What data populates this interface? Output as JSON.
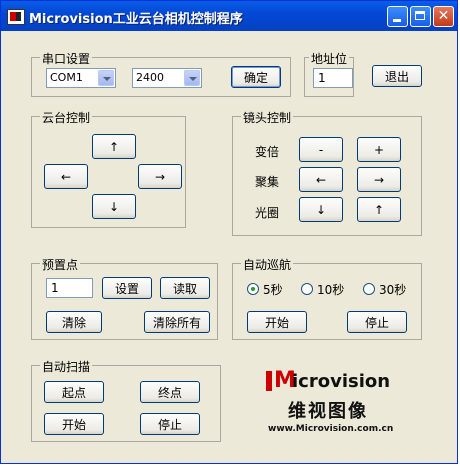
{
  "window": {
    "title": "Microvision工业云台相机控制程序"
  },
  "serial": {
    "legend": "串口设置",
    "port": "COM1",
    "baud": "2400",
    "confirm": "确定"
  },
  "address": {
    "legend": "地址位",
    "value": "1",
    "exit": "退出"
  },
  "ptz": {
    "legend": "云台控制",
    "up": "↑",
    "left": "←",
    "right": "→",
    "down": "↓"
  },
  "lens": {
    "legend": "镜头控制",
    "zoom_label": "变倍",
    "zoom_minus": "-",
    "zoom_plus": "+",
    "focus_label": "聚集",
    "focus_left": "←",
    "focus_right": "→",
    "iris_label": "光圈",
    "iris_down": "↓",
    "iris_up": "↑"
  },
  "preset": {
    "legend": "预置点",
    "value": "1",
    "set": "设置",
    "read": "读取",
    "clear": "清除",
    "clear_all": "清除所有"
  },
  "cruise": {
    "legend": "自动巡航",
    "opt1": "5秒",
    "opt2": "10秒",
    "opt3": "30秒",
    "selected": "5秒",
    "start": "开始",
    "stop": "停止"
  },
  "scan": {
    "legend": "自动扫描",
    "start_point": "起点",
    "end_point": "终点",
    "start": "开始",
    "stop": "停止"
  },
  "brand": {
    "logo_m": "M",
    "logo_rest": "icrovision",
    "cn": "维视图像",
    "url": "www.Microvision.com.cn",
    "color": "#cc0000"
  }
}
